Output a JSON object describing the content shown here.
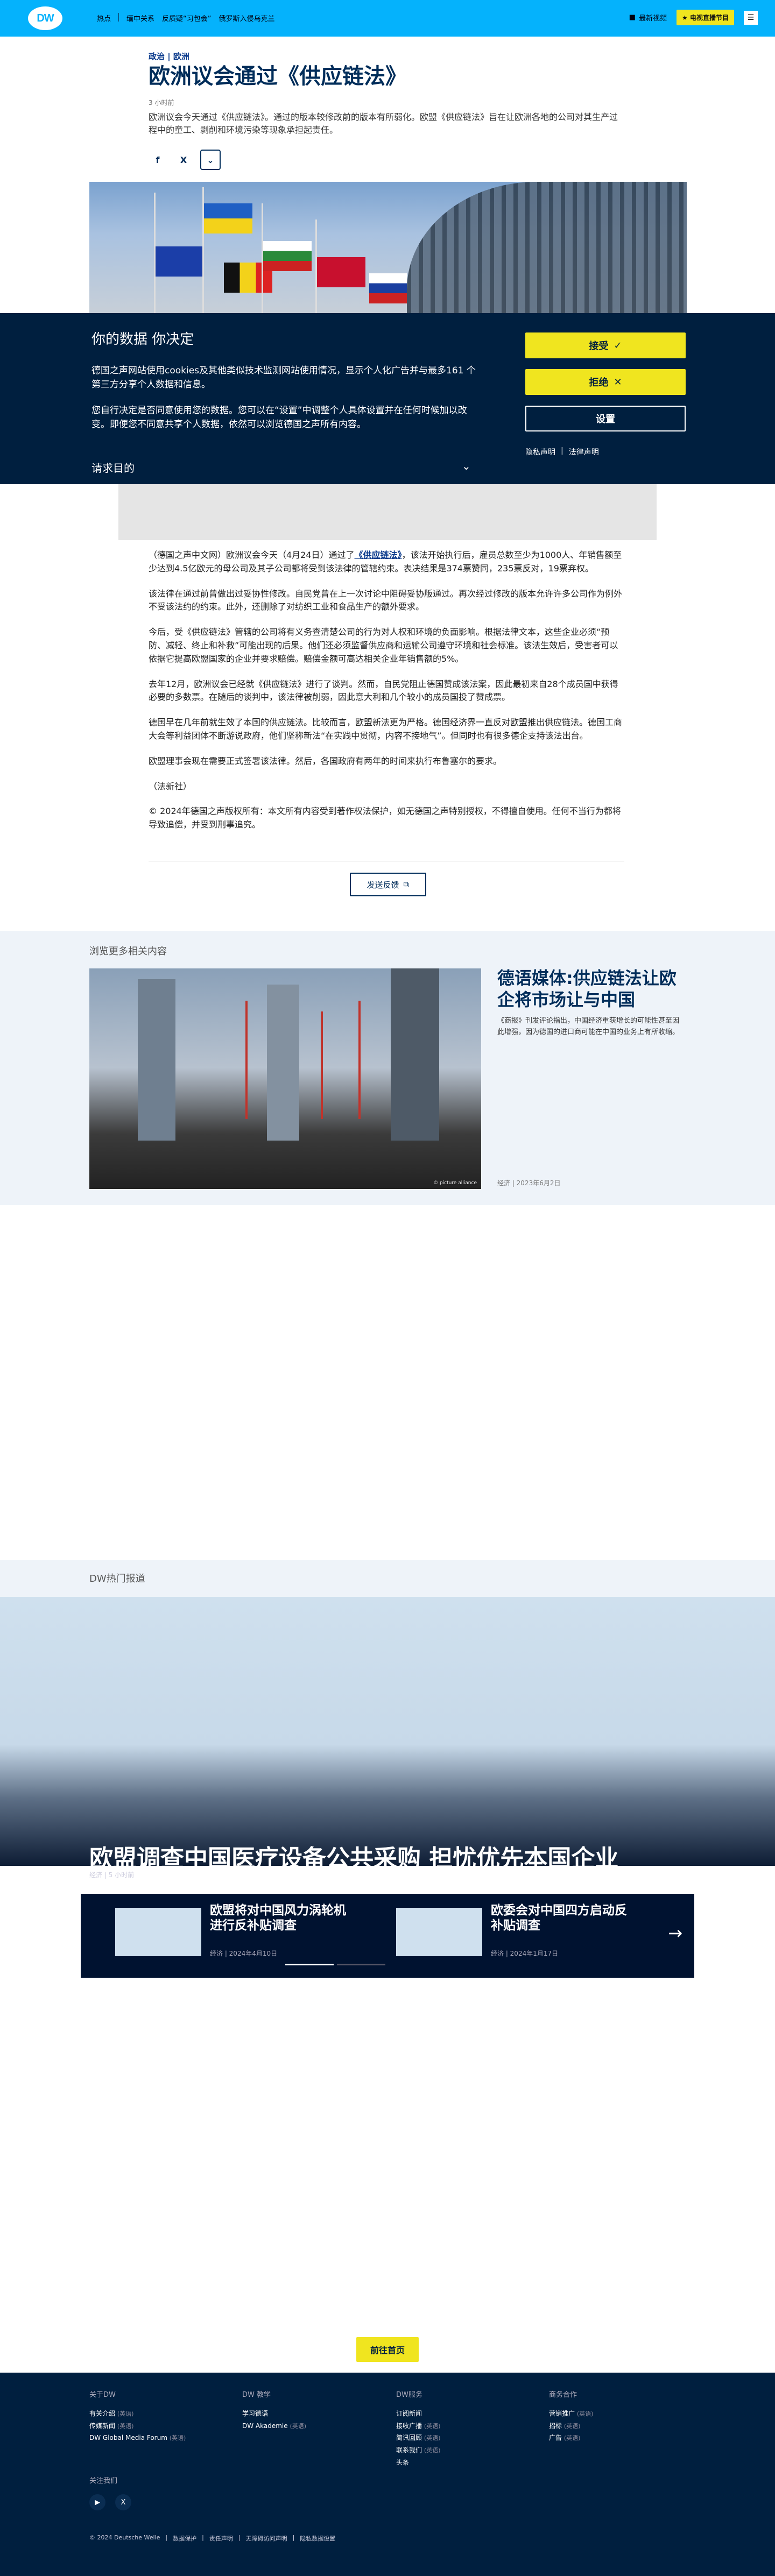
{
  "header": {
    "logo_text": "DW",
    "nav": [
      "热点",
      "缅中关系",
      "反质疑“习包会”",
      "俄罗斯入侵乌克兰"
    ],
    "tv_label": "最新视频",
    "program_label": "电视直播节目",
    "menu_icon": "menu-icon",
    "brand_color": "#05b2fc",
    "accent_color": "#f0e51f"
  },
  "article": {
    "kicker": "政治 | 欧洲",
    "title": "欧洲议会通过《供应链法》",
    "timeago": "3 小时前",
    "lead": "欧洲议会今天通过《供应链法》。通过的版本较修改前的版本有所弱化。欧盟《供应链法》旨在让欧洲各地的公司对其生产过程中的童工、剥削和环境污染等现象承担起责任。",
    "share": {
      "facebook": "f",
      "x": "X",
      "more": "⌄"
    }
  },
  "cookie": {
    "title": "你的数据 你决定",
    "p1": "德国之声网站使用cookies及其他类似技术监测网站使用情况，显示个人化广告并与最多161 个第三方分享个人数据和信息。",
    "p2": "您自行决定是否同意使用您的数据。您可以在“设置”中调整个人具体设置并在任何时候加以改变。即便您不同意共享个人数据，依然可以浏览德国之声所有内容。",
    "purpose": "请求目的",
    "accept": "接受",
    "reject": "拒绝",
    "settings": "设置",
    "privacy": "隐私声明",
    "legal": "法律声明",
    "separator": "|",
    "bg_color": "#001f3f"
  },
  "body": {
    "p1_a": "（德国之声中文网）欧洲议会今天（4月24日）通过了",
    "p1_link": "《供应链法》",
    "p1_b": "，该法开始执行后，雇员总数至少为1000人、年销售额至少达到4.5亿欧元的母公司及其子公司都将受到该法律的管辖约束。表决结果是374票赞同，235票反对，19票弃权。",
    "p2": "该法律在通过前曾做出过妥协性修改。自民党曾在上一次讨论中阻碍妥协版通过。再次经过修改的版本允许许多公司作为例外不受该法约的约束。此外，还删除了对纺织工业和食品生产的额外要求。",
    "p3": "今后，受《供应链法》管辖的公司将有义务查清楚公司的行为对人权和环境的负面影响。根据法律文本，这些企业必须“预防、减轻、终止和补救”可能出现的后果。他们还必须监督供应商和运输公司遵守环境和社会标准。该法生效后，受害者可以依据它提高欧盟国家的企业并要求赔偿。赔偿金额可高达相关企业年销售额的5%。",
    "p4": "去年12月，欧洲议会已经就《供应链法》进行了谈判。然而，自民党阻止德国赞成该法案，因此最初来自28个成员国中获得必要的多数票。在随后的谈判中，该法律被削弱，因此意大利和几个较小的成员国投了赞成票。",
    "p5": "德国早在几年前就生效了本国的供应链法。比较而言，欧盟新法更为严格。德国经济界一直反对欧盟推出供应链法。德国工商大会等利益团体不断游说政府，他们坚称新法“在实践中贯彻，内容不接地气”。但同时也有很多德企支持该法出台。",
    "p6": "欧盟理事会现在需要正式签署该法律。然后，各国政府有两年的时间来执行布鲁塞尔的要求。",
    "p7": "（法新社）",
    "p8": "© 2024年德国之声版权所有：本文所有内容受到著作权法保护，如无德国之声特别授权，不得擅自使用。任何不当行为都将导致追偿，并受到刑事追究。",
    "feedback": "发送反馈"
  },
  "related": {
    "label": "浏览更多相关内容",
    "title": "德语媒体:供应链法让欧企将市场让与中国",
    "summary": "《商报》刊发评论指出，中国经济重获增长的可能性甚至因此增强，因为德国的进口商可能在中国的业务上有所收缩。",
    "image_credit": "© picture alliance",
    "meta": "经济 | 2023年6月2日"
  },
  "trending": {
    "label": "DW热门报道",
    "title": "欧盟调查中国医疗设备公共采购 担忧优先本国企业",
    "meta": "经济 | 5 小时前",
    "cards": [
      {
        "title": "欧盟将对中国风力涡轮机进行反补贴调查",
        "meta": "经济 | 2024年4月10日"
      },
      {
        "title": "欧委会对中国四方启动反补贴调查",
        "meta": "经济 | 2024年1月17日"
      }
    ]
  },
  "home_button": "前往首页",
  "footer": {
    "cols": [
      {
        "title": "关于DW",
        "items": [
          [
            "有关介绍",
            "(英语)"
          ],
          [
            "传媒新闻",
            "(英语)"
          ],
          [
            "DW Global Media Forum",
            "(英语)"
          ]
        ]
      },
      {
        "title": "DW 教学",
        "items": [
          [
            "学习德语",
            ""
          ],
          [
            "DW Akademie",
            "(英语)"
          ]
        ]
      },
      {
        "title": "DW服务",
        "items": [
          [
            "订阅新闻",
            ""
          ],
          [
            "接收广播",
            "(英语)"
          ],
          [
            "简讯回顾",
            "(英语)"
          ],
          [
            "联系我们",
            "(英语)"
          ],
          [
            "头条",
            ""
          ]
        ]
      },
      {
        "title": "商务合作",
        "items": [
          [
            "营销推广",
            "(英语)"
          ],
          [
            "招标",
            "(英语)"
          ],
          [
            "广告",
            "(英语)"
          ]
        ]
      }
    ],
    "follow_label": "关注我们",
    "bottom": [
      "© 2024 Deutsche Welle",
      "数据保护",
      "责任声明",
      "无障碍访问声明",
      "隐私数据设置"
    ]
  }
}
